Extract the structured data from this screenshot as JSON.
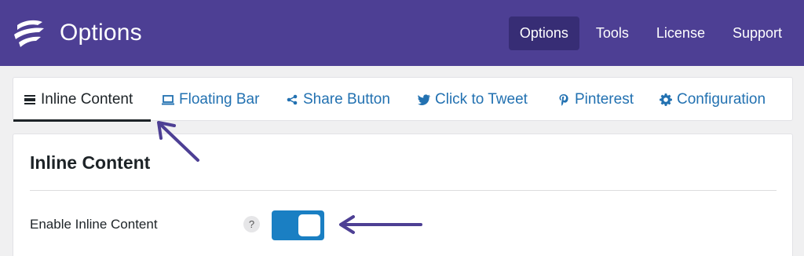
{
  "header": {
    "title": "Options",
    "logo": "sitemap-feather-logo",
    "colors": {
      "background": "#4d3f94",
      "active_item": "#372d75"
    },
    "nav": [
      {
        "label": "Options",
        "active": true
      },
      {
        "label": "Tools",
        "active": false
      },
      {
        "label": "License",
        "active": false
      },
      {
        "label": "Support",
        "active": false
      }
    ]
  },
  "tabs": [
    {
      "label": "Inline Content",
      "icon": "inline-content-icon",
      "active": true
    },
    {
      "label": "Floating Bar",
      "icon": "laptop-icon",
      "active": false
    },
    {
      "label": "Share Button",
      "icon": "share-icon",
      "active": false
    },
    {
      "label": "Click to Tweet",
      "icon": "twitter-icon",
      "active": false
    },
    {
      "label": "Pinterest",
      "icon": "pinterest-icon",
      "active": false
    },
    {
      "label": "Configuration",
      "icon": "gear-icon",
      "active": false
    }
  ],
  "section": {
    "title": "Inline Content",
    "fields": [
      {
        "label": "Enable Inline Content",
        "help": "?",
        "type": "toggle",
        "enabled": true
      }
    ]
  },
  "colors": {
    "link": "#2271b1",
    "toggle_on": "#1a7fc3",
    "annotation_arrow": "#4d3f94"
  }
}
